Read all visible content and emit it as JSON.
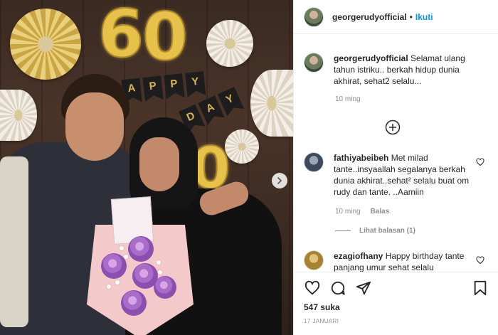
{
  "photo": {
    "balloon_digits": [
      "6",
      "0",
      "0"
    ],
    "banner_letters": [
      "A",
      "P",
      "P",
      "Y"
    ],
    "banner2_letters": [
      "D",
      "A",
      "Y"
    ]
  },
  "header": {
    "username": "georgerudyofficial",
    "separator": "•",
    "follow_label": "Ikuti"
  },
  "caption": {
    "username": "georgerudyofficial",
    "text": "Selamat ulang tahun istriku.. berkah hidup dunia akhirat, sehat2 selalu...",
    "time": "10 ming"
  },
  "comments": [
    {
      "username": "fathiyabeibeh",
      "text": "Met milad tante..insyaallah segalanya berkah dunia akhirat..sehat² selalu buat om rudy dan tante. ..Aamiin",
      "time": "10 ming",
      "reply_label": "Balas",
      "view_replies": "Lihat balasan (1)"
    },
    {
      "username": "ezagiofhany",
      "text": "Happy birthday tante panjang umur sehat selalu"
    }
  ],
  "actions": {
    "likes": "547 suka",
    "date": "17 JANUARI"
  },
  "colors": {
    "link": "#0095f6",
    "muted": "#8e8e8e",
    "text": "#262626"
  },
  "icons": [
    "heart-icon",
    "comment-icon",
    "share-icon",
    "bookmark-icon",
    "plus-circle-icon",
    "chevron-right-icon"
  ]
}
